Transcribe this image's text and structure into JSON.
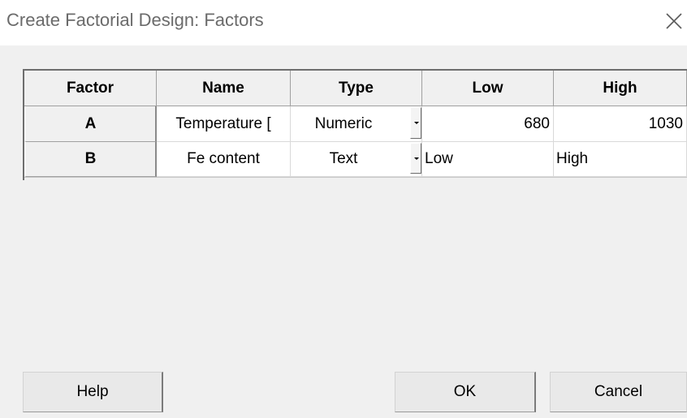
{
  "window": {
    "title": "Create Factorial Design: Factors"
  },
  "grid": {
    "columns": [
      "Factor",
      "Name",
      "Type",
      "Low",
      "High"
    ],
    "rows": [
      {
        "factor": "A",
        "name": "Temperature [",
        "type": "Numeric",
        "low": "680",
        "high": "1030"
      },
      {
        "factor": "B",
        "name": "Fe content",
        "type": "Text",
        "low": "Low",
        "high": "High"
      }
    ]
  },
  "buttons": {
    "help": "Help",
    "ok": "OK",
    "cancel": "Cancel"
  },
  "icons": {
    "close": "close-icon",
    "dropdown": "chevron-down-icon"
  },
  "colors": {
    "dialog_background": "#f0f0f0",
    "title_text": "#6b6b6b",
    "cell_background": "#ffffff"
  }
}
